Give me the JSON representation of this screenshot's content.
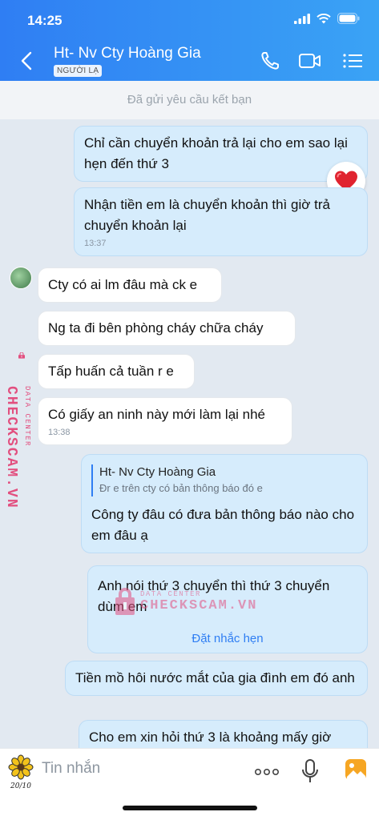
{
  "status_bar": {
    "time": "14:25"
  },
  "header": {
    "contact_name": "Ht- Nv Cty Hoàng Gia",
    "badge": "NGƯỜI LẠ",
    "icons": [
      "back-icon",
      "phone-icon",
      "video-call-icon",
      "menu-list-icon"
    ]
  },
  "friend_request_bar": "Đã gửi yêu cầu kết bạn",
  "messages": [
    {
      "dir": "out",
      "text": "Chỉ cần chuyển khoản trả lại cho em sao lại hẹn đến thứ 3"
    },
    {
      "dir": "out",
      "text": "Nhận tiền em là chuyển khoản thì giờ trả chuyển khoản lại",
      "time": "13:37"
    },
    {
      "dir": "in",
      "text": "Cty có ai lm đâu mà ck e"
    },
    {
      "dir": "in",
      "text": "Ng ta đi bên phòng cháy chữa cháy"
    },
    {
      "dir": "in",
      "text": "Tấp huấn cả tuần r e"
    },
    {
      "dir": "in",
      "text": "Có giấy an ninh này mới làm lại nhé",
      "time": "13:38"
    },
    {
      "dir": "out",
      "quote_name": "Ht- Nv Cty Hoàng Gia",
      "quote_text": "Đr e trên cty có bản thông báo đó e",
      "text": "Công ty đâu có đưa bản thông báo nào cho em đâu ạ"
    },
    {
      "dir": "out",
      "text": "Anh nói thứ 3 chuyển thì thứ 3 chuyển dùm em",
      "link": "Đặt nhắc hẹn"
    },
    {
      "dir": "out",
      "text": "Tiền mồ hôi nước mắt của gia đình em đó anh"
    },
    {
      "dir": "out",
      "text": "Cho em xin hỏi thứ 3 là khoảng mấy giờ"
    }
  ],
  "reaction": "heart",
  "watermark": {
    "main": "CHECKSCAM.VN",
    "sub": "DATA CENTER"
  },
  "composer": {
    "placeholder": "Tin nhắn",
    "sticker_label": "20/10"
  },
  "colors": {
    "header_start": "#2f7ef3",
    "header_end": "#3aa3f5",
    "outgoing_bubble": "#d6ecfc",
    "incoming_bubble": "#ffffff",
    "link": "#2f7ef3",
    "watermark": "#e24f7f"
  }
}
